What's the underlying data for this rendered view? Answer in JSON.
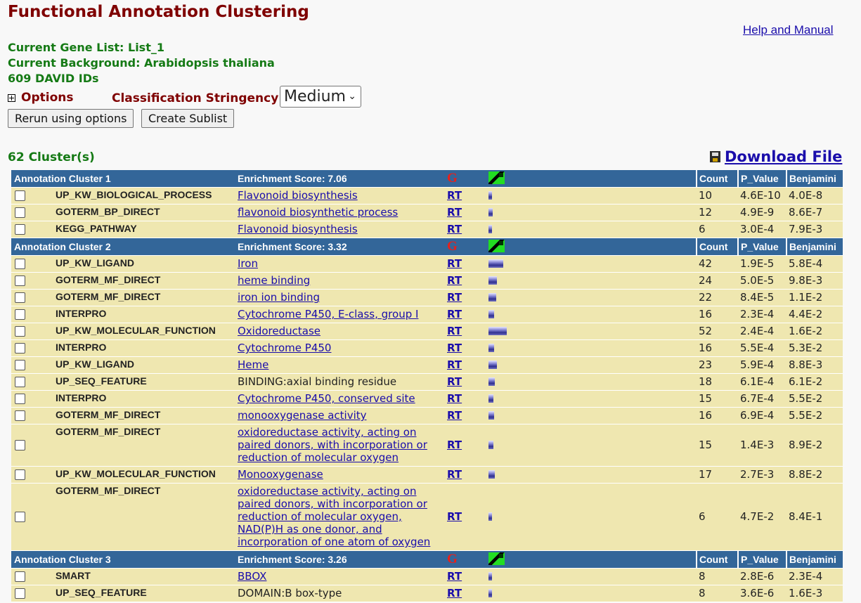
{
  "page_title": "Functional Annotation Clustering",
  "help_link": "Help and Manual",
  "info": {
    "gene_list": "Current Gene List: List_1",
    "background": "Current Background: Arabidopsis thaliana",
    "ids": "609 DAVID IDs"
  },
  "options": {
    "label": "Options",
    "stringency_label": "Classification Stringency",
    "stringency_value": "Medium",
    "rerun_button": "Rerun using options",
    "sublist_button": "Create Sublist"
  },
  "cluster_count": "62 Cluster(s)",
  "download": "Download File",
  "columns": {
    "count": "Count",
    "pvalue": "P_Value",
    "benjamini": "Benjamini"
  },
  "cluster_icons": {
    "g": "G",
    "rt": "RT"
  },
  "clusters": [
    {
      "name": "Annotation Cluster 1",
      "score": "Enrichment Score: 7.06",
      "rows": [
        {
          "cat": "UP_KW_BIOLOGICAL_PROCESS",
          "term": "Flavonoid biosynthesis",
          "link": true,
          "count": "10",
          "p": "4.6E-10",
          "b": "4.0E-8"
        },
        {
          "cat": "GOTERM_BP_DIRECT",
          "term": "flavonoid biosynthetic process",
          "link": true,
          "count": "12",
          "p": "4.9E-9",
          "b": "8.6E-7"
        },
        {
          "cat": "KEGG_PATHWAY",
          "term": "Flavonoid biosynthesis",
          "link": true,
          "count": "6",
          "p": "3.0E-4",
          "b": "7.9E-3"
        }
      ]
    },
    {
      "name": "Annotation Cluster 2",
      "score": "Enrichment Score: 3.32",
      "rows": [
        {
          "cat": "UP_KW_LIGAND",
          "term": "Iron",
          "link": true,
          "count": "42",
          "p": "1.9E-5",
          "b": "5.8E-4"
        },
        {
          "cat": "GOTERM_MF_DIRECT",
          "term": "heme binding",
          "link": true,
          "count": "24",
          "p": "5.0E-5",
          "b": "9.8E-3"
        },
        {
          "cat": "GOTERM_MF_DIRECT",
          "term": "iron ion binding",
          "link": true,
          "count": "22",
          "p": "8.4E-5",
          "b": "1.1E-2"
        },
        {
          "cat": "INTERPRO",
          "term": "Cytochrome P450, E-class, group I",
          "link": true,
          "count": "16",
          "p": "2.3E-4",
          "b": "4.4E-2"
        },
        {
          "cat": "UP_KW_MOLECULAR_FUNCTION",
          "term": "Oxidoreductase",
          "link": true,
          "count": "52",
          "p": "2.4E-4",
          "b": "1.6E-2"
        },
        {
          "cat": "INTERPRO",
          "term": "Cytochrome P450",
          "link": true,
          "count": "16",
          "p": "5.5E-4",
          "b": "5.3E-2"
        },
        {
          "cat": "UP_KW_LIGAND",
          "term": "Heme",
          "link": true,
          "count": "23",
          "p": "5.9E-4",
          "b": "8.8E-3"
        },
        {
          "cat": "UP_SEQ_FEATURE",
          "term": "BINDING:axial binding residue",
          "link": false,
          "count": "18",
          "p": "6.1E-4",
          "b": "6.1E-2"
        },
        {
          "cat": "INTERPRO",
          "term": "Cytochrome P450, conserved site",
          "link": true,
          "count": "15",
          "p": "6.7E-4",
          "b": "5.5E-2"
        },
        {
          "cat": "GOTERM_MF_DIRECT",
          "term": "monooxygenase activity",
          "link": true,
          "count": "16",
          "p": "6.9E-4",
          "b": "5.5E-2"
        },
        {
          "cat": "GOTERM_MF_DIRECT",
          "term": "oxidoreductase activity, acting on paired donors, with incorporation or reduction of molecular oxygen",
          "link": true,
          "count": "15",
          "p": "1.4E-3",
          "b": "8.9E-2"
        },
        {
          "cat": "UP_KW_MOLECULAR_FUNCTION",
          "term": "Monooxygenase",
          "link": true,
          "count": "17",
          "p": "2.7E-3",
          "b": "8.8E-2"
        },
        {
          "cat": "GOTERM_MF_DIRECT",
          "term": "oxidoreductase activity, acting on paired donors, with incorporation or reduction of molecular oxygen, NAD(P)H as one donor, and incorporation of one atom of oxygen",
          "link": true,
          "count": "6",
          "p": "4.7E-2",
          "b": "8.4E-1"
        }
      ]
    },
    {
      "name": "Annotation Cluster 3",
      "score": "Enrichment Score: 3.26",
      "rows": [
        {
          "cat": "SMART",
          "term": "BBOX",
          "link": true,
          "count": "8",
          "p": "2.8E-6",
          "b": "2.3E-4"
        },
        {
          "cat": "UP_SEQ_FEATURE",
          "term": "DOMAIN:B box-type",
          "link": false,
          "count": "8",
          "p": "3.6E-6",
          "b": "1.6E-3"
        }
      ]
    }
  ]
}
